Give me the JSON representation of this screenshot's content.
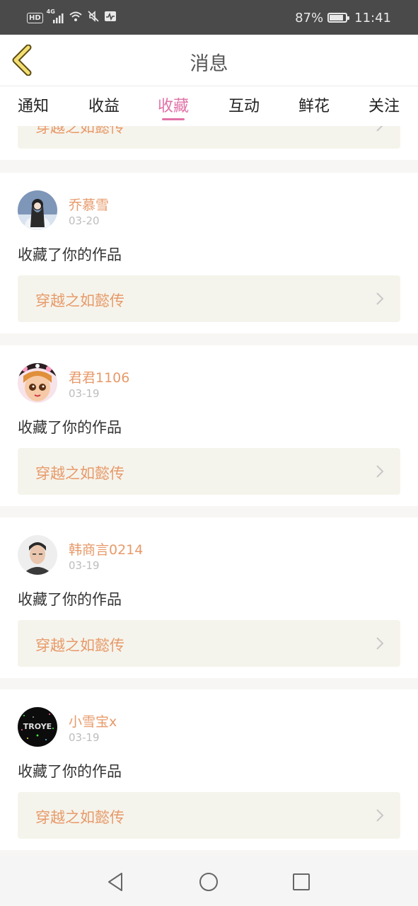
{
  "status": {
    "network": "4G",
    "hd": "HD",
    "battery_percent": "87%",
    "battery_level": 0.87,
    "time": "11:41"
  },
  "header": {
    "title": "消息",
    "back_icon": "chevron-left-icon"
  },
  "tabs": [
    {
      "label": "通知"
    },
    {
      "label": "收益"
    },
    {
      "label": "收藏",
      "active": true
    },
    {
      "label": "互动"
    },
    {
      "label": "鲜花"
    },
    {
      "label": "关注"
    }
  ],
  "partial_item": {
    "work_title": "穿越之如懿传"
  },
  "messages": [
    {
      "user": "乔慕雪",
      "date": "03-20",
      "action": "收藏了你的作品",
      "work_title": "穿越之如懿传"
    },
    {
      "user": "君君1106",
      "date": "03-19",
      "action": "收藏了你的作品",
      "work_title": "穿越之如懿传"
    },
    {
      "user": "韩商言0214",
      "date": "03-19",
      "action": "收藏了你的作品",
      "work_title": "穿越之如懿传"
    },
    {
      "user": "小雪宝x",
      "date": "03-19",
      "action": "收藏了你的作品",
      "work_title": "穿越之如懿传"
    }
  ],
  "nav": {
    "back": "triangle-back-icon",
    "home": "circle-home-icon",
    "recents": "square-recents-icon"
  },
  "colors": {
    "accent": "#e172a8",
    "name": "#e79a6a",
    "card_link_bg": "#f5f4ec",
    "status_bar": "#4a4a4a"
  }
}
